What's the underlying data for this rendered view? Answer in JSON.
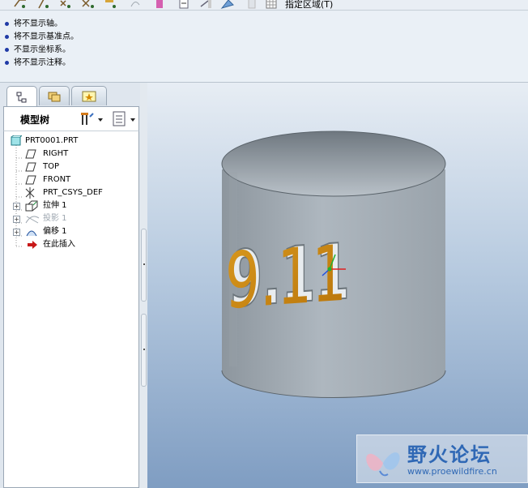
{
  "toolbar": {
    "region_label": "指定区域(T)",
    "buttons": [
      "datum-planes-display",
      "datum-axes-display",
      "datum-points-display",
      "csys-display",
      "annotation-display",
      "spin-center",
      "repaint",
      "import",
      "export",
      "appearance",
      "blank",
      "select-region"
    ]
  },
  "messages": [
    "将不显示轴。",
    "将不显示基准点。",
    "不显示坐标系。",
    "将不显示注释。"
  ],
  "panel": {
    "tabs": [
      "model-tree-tab",
      "folder-browser-tab",
      "favorites-tab"
    ],
    "title": "模型树"
  },
  "tree": {
    "items": [
      {
        "label": "PRT0001.PRT",
        "icon": "part-icon",
        "expandable": false,
        "dim": false
      },
      {
        "label": "RIGHT",
        "icon": "datum-plane-icon",
        "expandable": false,
        "dim": false
      },
      {
        "label": "TOP",
        "icon": "datum-plane-icon",
        "expandable": false,
        "dim": false
      },
      {
        "label": "FRONT",
        "icon": "datum-plane-icon",
        "expandable": false,
        "dim": false
      },
      {
        "label": "PRT_CSYS_DEF",
        "icon": "csys-icon",
        "expandable": false,
        "dim": false
      },
      {
        "label": "拉伸 1",
        "icon": "extrude-icon",
        "expandable": true,
        "dim": false
      },
      {
        "label": "投影 1",
        "icon": "project-icon",
        "expandable": true,
        "dim": true
      },
      {
        "label": "偏移 1",
        "icon": "offset-icon",
        "expandable": true,
        "dim": false
      },
      {
        "label": "在此插入",
        "icon": "insert-here-icon",
        "expandable": false,
        "dim": false
      }
    ]
  },
  "model": {
    "embossed_text": "9.11",
    "cylinder_color": "#a7b0b8",
    "text_color": "#c8860c"
  },
  "watermark": {
    "title": "野火论坛",
    "url": "www.proewildfire.cn"
  }
}
